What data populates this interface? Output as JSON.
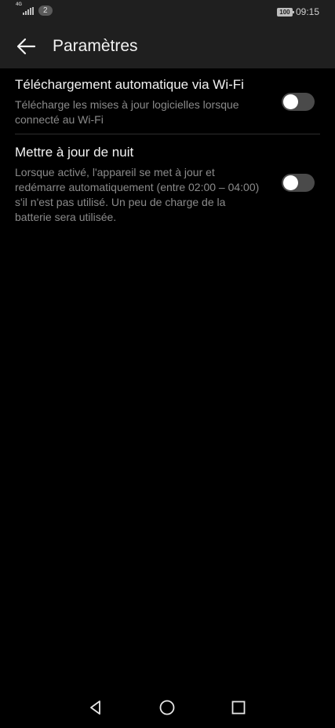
{
  "status_bar": {
    "network_type": "4G",
    "notification_count": "2",
    "battery": "100",
    "time": "09:15"
  },
  "header": {
    "back_icon": "arrow-left-icon",
    "title": "Paramètres"
  },
  "settings": [
    {
      "title": "Téléchargement automatique via Wi-Fi",
      "description": "Télécharge les mises à jour logicielles lorsque connecté au Wi-Fi",
      "enabled": false
    },
    {
      "title": "Mettre à jour de nuit",
      "description": "Lorsque activé, l'appareil se met à jour et redémarre automatiquement (entre 02:00 – 04:00) s'il n'est pas utilisé. Un peu de charge de la batterie sera utilisée.",
      "enabled": false
    }
  ],
  "nav_bar": {
    "icons": [
      "triangle-back-icon",
      "circle-home-icon",
      "square-recents-icon"
    ]
  },
  "colors": {
    "background": "#000000",
    "bar": "#1f1f1f",
    "toggle_off": "#4a4a4a",
    "secondary_text": "#8a8a8a"
  }
}
